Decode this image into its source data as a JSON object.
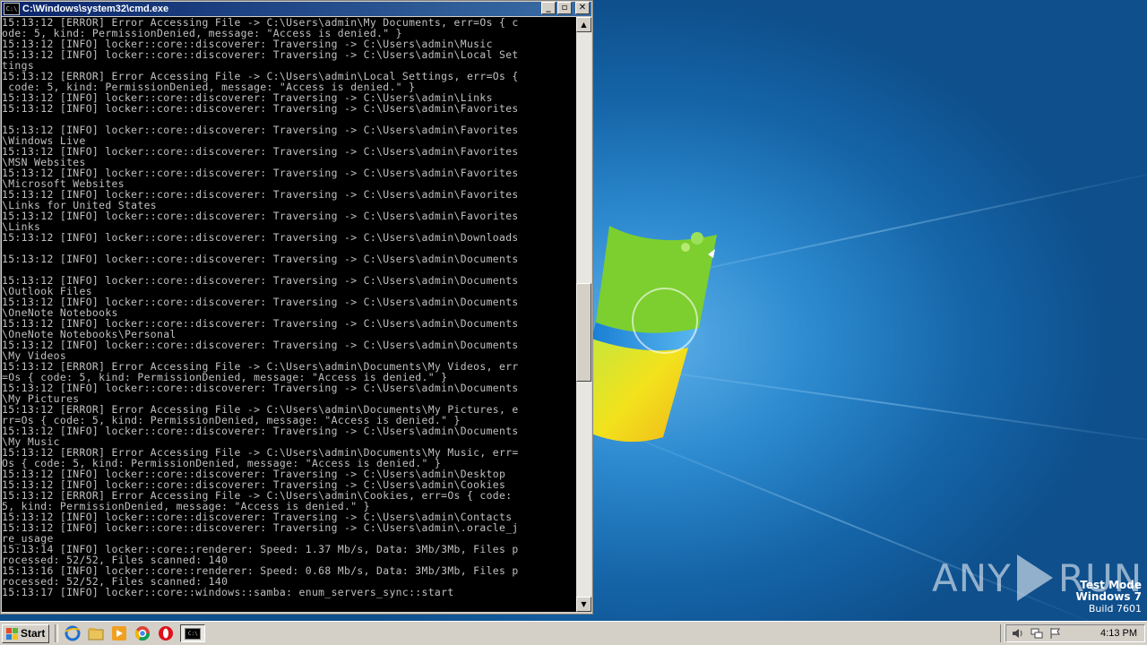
{
  "window": {
    "title": "C:\\Windows\\system32\\cmd.exe",
    "icon_text": "C:\\",
    "minimize_label": "_",
    "maximize_label": "▫",
    "close_label": "✕"
  },
  "console": {
    "lines": [
      "15:13:12 [ERROR] Error Accessing File -> C:\\Users\\admin\\My Documents, err=Os { c",
      "ode: 5, kind: PermissionDenied, message: \"Access is denied.\" }",
      "15:13:12 [INFO] locker::core::discoverer: Traversing -> C:\\Users\\admin\\Music",
      "15:13:12 [INFO] locker::core::discoverer: Traversing -> C:\\Users\\admin\\Local Set",
      "tings",
      "15:13:12 [ERROR] Error Accessing File -> C:\\Users\\admin\\Local Settings, err=Os {",
      " code: 5, kind: PermissionDenied, message: \"Access is denied.\" }",
      "15:13:12 [INFO] locker::core::discoverer: Traversing -> C:\\Users\\admin\\Links",
      "15:13:12 [INFO] locker::core::discoverer: Traversing -> C:\\Users\\admin\\Favorites",
      "",
      "15:13:12 [INFO] locker::core::discoverer: Traversing -> C:\\Users\\admin\\Favorites",
      "\\Windows Live",
      "15:13:12 [INFO] locker::core::discoverer: Traversing -> C:\\Users\\admin\\Favorites",
      "\\MSN Websites",
      "15:13:12 [INFO] locker::core::discoverer: Traversing -> C:\\Users\\admin\\Favorites",
      "\\Microsoft Websites",
      "15:13:12 [INFO] locker::core::discoverer: Traversing -> C:\\Users\\admin\\Favorites",
      "\\Links for United States",
      "15:13:12 [INFO] locker::core::discoverer: Traversing -> C:\\Users\\admin\\Favorites",
      "\\Links",
      "15:13:12 [INFO] locker::core::discoverer: Traversing -> C:\\Users\\admin\\Downloads",
      "",
      "15:13:12 [INFO] locker::core::discoverer: Traversing -> C:\\Users\\admin\\Documents",
      "",
      "15:13:12 [INFO] locker::core::discoverer: Traversing -> C:\\Users\\admin\\Documents",
      "\\Outlook Files",
      "15:13:12 [INFO] locker::core::discoverer: Traversing -> C:\\Users\\admin\\Documents",
      "\\OneNote Notebooks",
      "15:13:12 [INFO] locker::core::discoverer: Traversing -> C:\\Users\\admin\\Documents",
      "\\OneNote Notebooks\\Personal",
      "15:13:12 [INFO] locker::core::discoverer: Traversing -> C:\\Users\\admin\\Documents",
      "\\My Videos",
      "15:13:12 [ERROR] Error Accessing File -> C:\\Users\\admin\\Documents\\My Videos, err",
      "=Os { code: 5, kind: PermissionDenied, message: \"Access is denied.\" }",
      "15:13:12 [INFO] locker::core::discoverer: Traversing -> C:\\Users\\admin\\Documents",
      "\\My Pictures",
      "15:13:12 [ERROR] Error Accessing File -> C:\\Users\\admin\\Documents\\My Pictures, e",
      "rr=Os { code: 5, kind: PermissionDenied, message: \"Access is denied.\" }",
      "15:13:12 [INFO] locker::core::discoverer: Traversing -> C:\\Users\\admin\\Documents",
      "\\My Music",
      "15:13:12 [ERROR] Error Accessing File -> C:\\Users\\admin\\Documents\\My Music, err=",
      "Os { code: 5, kind: PermissionDenied, message: \"Access is denied.\" }",
      "15:13:12 [INFO] locker::core::discoverer: Traversing -> C:\\Users\\admin\\Desktop",
      "15:13:12 [INFO] locker::core::discoverer: Traversing -> C:\\Users\\admin\\Cookies",
      "15:13:12 [ERROR] Error Accessing File -> C:\\Users\\admin\\Cookies, err=Os { code:",
      "5, kind: PermissionDenied, message: \"Access is denied.\" }",
      "15:13:12 [INFO] locker::core::discoverer: Traversing -> C:\\Users\\admin\\Contacts",
      "15:13:12 [INFO] locker::core::discoverer: Traversing -> C:\\Users\\admin\\.oracle_j",
      "re_usage",
      "15:13:14 [INFO] locker::core::renderer: Speed: 1.37 Mb/s, Data: 3Mb/3Mb, Files p",
      "rocessed: 52/52, Files scanned: 140",
      "15:13:16 [INFO] locker::core::renderer: Speed: 0.68 Mb/s, Data: 3Mb/3Mb, Files p",
      "rocessed: 52/52, Files scanned: 140",
      "15:13:17 [INFO] locker::core::windows::samba: enum_servers_sync::start"
    ]
  },
  "watermark": {
    "left": "ANY",
    "right": "RUN"
  },
  "test_mode": {
    "line1": "Test Mode",
    "line2": "Windows 7",
    "line3": "Build 7601"
  },
  "taskbar": {
    "start_label": "Start",
    "quick_launch": [
      "ie-icon",
      "explorer-icon",
      "media-player-icon",
      "chrome-icon",
      "opera-icon"
    ],
    "task_cmd_icon_text": "C:\\",
    "clock": "4:13 PM"
  },
  "colors": {
    "console_bg": "#000000",
    "console_text": "#c0c0c0",
    "titlebar_start": "#0a246a",
    "titlebar_end": "#3a6ea5",
    "desktop_blue": "#1f73b8"
  }
}
